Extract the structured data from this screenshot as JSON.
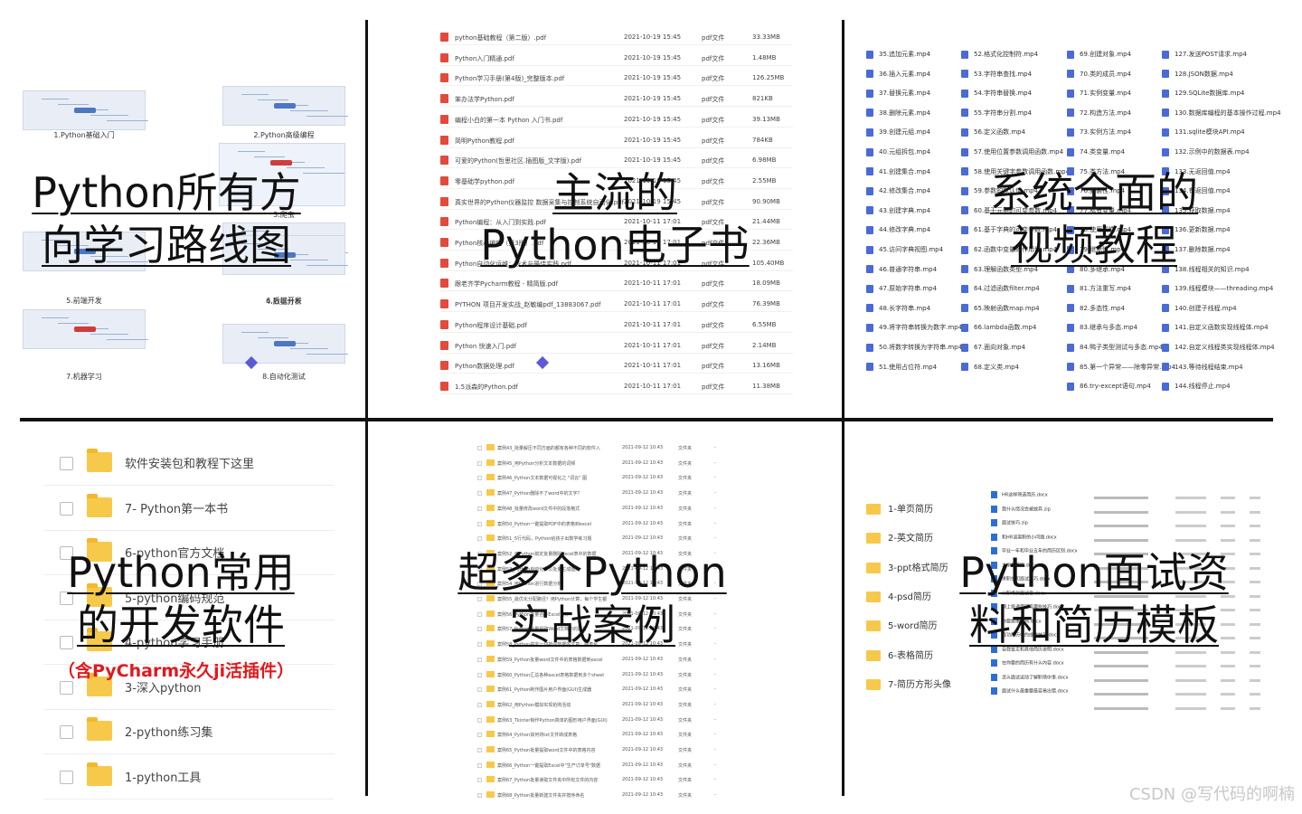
{
  "panels": {
    "p1": {
      "title_line1": "Python所有方",
      "title_line2": "向学习路线图",
      "thumbs": [
        "1.Python基础入门",
        "2.Python高级编程",
        "3.爬虫",
        "4.数据分析",
        "5.前端开发",
        "6.后端开发",
        "7.机器学习",
        "8.自动化测试"
      ]
    },
    "p2": {
      "title_line1": "主流的",
      "title_line2": "Python电子书",
      "files": [
        {
          "name": "python基础教程（第二版）.pdf",
          "date": "2021-10-19 15:45",
          "type": "pdf文件",
          "size": "33.33MB"
        },
        {
          "name": "Python入门精通.pdf",
          "date": "2021-10-19 15:45",
          "type": "pdf文件",
          "size": "1.48MB"
        },
        {
          "name": "Python学习手册(第4版)_完整版本.pdf",
          "date": "2021-10-19 15:45",
          "type": "pdf文件",
          "size": "126.25MB"
        },
        {
          "name": "笨办法学Python.pdf",
          "date": "2021-10-19 15:45",
          "type": "pdf文件",
          "size": "821KB"
        },
        {
          "name": "编程小白的第一本 Python 入门书.pdf",
          "date": "2021-10-19 15:45",
          "type": "pdf文件",
          "size": "39.13MB"
        },
        {
          "name": "简明Python教程.pdf",
          "date": "2021-10-19 15:45",
          "type": "pdf文件",
          "size": "784KB"
        },
        {
          "name": "可爱的Python(哲思社区.插图版_文字版).pdf",
          "date": "2021-10-19 15:45",
          "type": "pdf文件",
          "size": "6.98MB"
        },
        {
          "name": "零基础学python.pdf",
          "date": "2021-10-19 15:45",
          "type": "pdf文件",
          "size": "2.55MB"
        },
        {
          "name": "真实世界的Python仪器监控 数据采集与控制系统自动化.pdf",
          "date": "2021-10-19 15:45",
          "type": "pdf文件",
          "size": "90.90MB"
        },
        {
          "name": "Python编程：从入门到实践.pdf",
          "date": "2021-10-11 17:01",
          "type": "pdf文件",
          "size": "21.44MB"
        },
        {
          "name": "Python核心编程（第3版）.pdf",
          "date": "2021-10-11 17:01",
          "type": "pdf文件",
          "size": "22.36MB"
        },
        {
          "name": "Python自动化运维：技术与最佳实践.pdf",
          "date": "2021-10-11 17:01",
          "type": "pdf文件",
          "size": "105.40MB"
        },
        {
          "name": "跟老齐学Pycharm教程 - 精简版.pdf",
          "date": "2021-10-11 17:01",
          "type": "pdf文件",
          "size": "18.09MB"
        },
        {
          "name": "PYTHON 项目开发实战_赵敏编pdf_13883067.pdf",
          "date": "2021-10-11 17:01",
          "type": "pdf文件",
          "size": "76.39MB"
        },
        {
          "name": "Python程序设计基础.pdf",
          "date": "2021-10-11 17:01",
          "type": "pdf文件",
          "size": "6.55MB"
        },
        {
          "name": "Python 快速入门.pdf",
          "date": "2021-10-11 17:01",
          "type": "pdf文件",
          "size": "2.14MB"
        },
        {
          "name": "Python数据处理.pdf",
          "date": "2021-10-11 17:01",
          "type": "pdf文件",
          "size": "13.16MB"
        },
        {
          "name": "1.5派森的Python.pdf",
          "date": "2021-10-11 17:01",
          "type": "pdf文件",
          "size": "11.38MB"
        }
      ]
    },
    "p3": {
      "title_line1": "系统全面的",
      "title_line2": "视频教程",
      "col1": [
        "35.追加元素.mp4",
        "36.插入元素.mp4",
        "37.替换元素.mp4",
        "38.删除元素.mp4",
        "39.创建元组.mp4",
        "40.元组拆包.mp4",
        "41.创建集合.mp4",
        "42.修改集合.mp4",
        "43.创建字典.mp4",
        "44.修改字典.mp4",
        "45.访问字典视图.mp4",
        "46.普通字符串.mp4",
        "47.原始字符串.mp4",
        "48.长字符串.mp4",
        "49.将字符串转换为数字.mp4",
        "50.将数字转换为字符串.mp4",
        "51.使用占位符.mp4"
      ],
      "col2": [
        "52.格式化控制符.mp4",
        "53.字符串查找.mp4",
        "54.字符串替换.mp4",
        "55.字符串分割.mp4",
        "56.定义函数.mp4",
        "57.使用位置参数调用函数.mp4",
        "58.使用关键字参数调用函数.mp4",
        "59.参数的默认值.mp4",
        "60.基于元组的可变参数.mp4",
        "61.基于字典的可变参数.mp4",
        "62.函数中变量的作用域.mp4",
        "63.理解函数类型.mp4",
        "64.过滤函数filter.mp4",
        "65.映射函数map.mp4",
        "66.lambda函数.mp4",
        "67.面向对象.mp4",
        "68.定义类.mp4"
      ],
      "col3": [
        "69.创建对象.mp4",
        "70.类的成员.mp4",
        "71.实例变量.mp4",
        "72.构造方法.mp4",
        "73.实例方法.mp4",
        "74.类变量.mp4",
        "75.类方法.mp4",
        "76.封装性.mp4",
        "77.私有变量.mp4",
        "78.使用属性.mp4",
        "79.继承性.mp4",
        "80.多继承.mp4",
        "81.方法重写.mp4",
        "82.多态性.mp4",
        "83.继承与多态.mp4",
        "84.鸭子类型测试与多态.mp4",
        "85.第一个异常——除零异常.mp4",
        "86.try-except语句.mp4"
      ],
      "col4": [
        "127.发送POST请求.mp4",
        "128.JSON数据.mp4",
        "129.SQLite数据库.mp4",
        "130.数据库编程的基本操作过程.mp4",
        "131.sqlite模块API.mp4",
        "132.示例中的数据表.mp4",
        "133.无返回值.mp4",
        "134.有返回值.mp4",
        "135.获取数据.mp4",
        "136.更新数据.mp4",
        "137.删除数据.mp4",
        "138.线程相关的知识.mp4",
        "139.线程模块——threading.mp4",
        "140.创建子线程.mp4",
        "141.自定义函数实现线程体.mp4",
        "142.自定义线程类实现线程体.mp4",
        "143.等待线程结束.mp4",
        "144.线程停止.mp4"
      ]
    },
    "p4": {
      "title_line1": "Python常用",
      "title_line2": "的开发软件",
      "subtitle": "（含PyCharm永久ji活插件）",
      "folders": [
        "软件安装包和教程下这里",
        "7- Python第一本书",
        "6-python官方文档",
        "5-python编码规范",
        "4-python学习手册",
        "3-深入python",
        "2-python练习集",
        "1-python工具"
      ]
    },
    "p5": {
      "title_line1": "超多个Python",
      "title_line2": "实战案例",
      "cases": [
        {
          "name": "案例43_批量解压不同方面的都有各种不同的软件入",
          "date": "2021-09-12 10:43",
          "type": "文件夹"
        },
        {
          "name": "案例45_用Python分析文本数据的词频",
          "date": "2021-09-12 10:43",
          "type": "文件夹"
        },
        {
          "name": "案例46_Python文本数据可视化之 \"词云\" 图",
          "date": "2021-09-12 10:43",
          "type": "文件夹"
        },
        {
          "name": "案例47_Python删除不了word中的文字？",
          "date": "2021-09-12 10:43",
          "type": "文件夹"
        },
        {
          "name": "案例48_批量修改word文件中的段落格式",
          "date": "2021-09-12 10:43",
          "type": "文件夹"
        },
        {
          "name": "案例50_Python一键提取PDF中的表格到excel",
          "date": "2021-09-12 10:43",
          "type": "文件夹"
        },
        {
          "name": "案例51_5行代码，Python给孩子出数学练习题",
          "date": "2021-09-12 10:43",
          "type": "文件夹"
        },
        {
          "name": "案例52_用Python搞定批量删除Excel表中的数据",
          "date": "2021-09-12 10:43",
          "type": "文件夹"
        },
        {
          "name": "案例53_Python自动化办公批量生成图片",
          "date": "2021-09-12 10:43",
          "type": "文件夹"
        },
        {
          "name": "案例54_用Python进行数据分析",
          "date": "2021-09-12 10:43",
          "type": "文件夹"
        },
        {
          "name": "案例55_最优化分配路径？用Python计算，每个学生都",
          "date": "2021-09-12 10:43",
          "type": "文件夹"
        },
        {
          "name": "案例56_Python批量合并Excel文件",
          "date": "2021-09-12 10:43",
          "type": "文件夹"
        },
        {
          "name": "案例57_Python批量提取Word文档中的图片",
          "date": "2021-09-12 10:43",
          "type": "文件夹"
        },
        {
          "name": "案例58_Python搞定一切新闻数据的文章：图表化",
          "date": "2021-09-12 10:43",
          "type": "文件夹"
        },
        {
          "name": "案例59_Python批量word文件中的表格数据到excel",
          "date": "2021-09-12 10:43",
          "type": "文件夹"
        },
        {
          "name": "案例60_Python汇总各种excel表格数据到多个sheet",
          "date": "2021-09-12 10:43",
          "type": "文件夹"
        },
        {
          "name": "案例61_Python制作图片用户界面(GUI)生成器",
          "date": "2021-09-12 10:43",
          "type": "文件夹"
        },
        {
          "name": "案例62_用Python模拟实现抢购活动",
          "date": "2021-09-12 10:43",
          "type": "文件夹"
        },
        {
          "name": "案例63_Tkinter制作Python简单的图形用户界面(GUI)",
          "date": "2021-09-12 10:43",
          "type": "文件夹"
        },
        {
          "name": "案例64_Python如何将txt文件转成表格",
          "date": "2021-09-12 10:43",
          "type": "文件夹"
        },
        {
          "name": "案例65_Python批量提取word文件中的表格内容",
          "date": "2021-09-12 10:43",
          "type": "文件夹"
        },
        {
          "name": "案例66_Python一键提取Excel中\"生产订单号\"数据",
          "date": "2021-09-12 10:43",
          "type": "文件夹"
        },
        {
          "name": "案例67_Python批量读取文件夹中所有文件的内容",
          "date": "2021-09-12 10:43",
          "type": "文件夹"
        },
        {
          "name": "案例68_Python批量新建文件夹并按序命名",
          "date": "2021-09-12 10:43",
          "type": "文件夹"
        }
      ]
    },
    "p6": {
      "title_line1": "Python面试资",
      "title_line2": "料和简历模板",
      "folders": [
        "1-单页简历",
        "2-英文简历",
        "3-ppt格式简历",
        "4-psd简历",
        "5-word简历",
        "6-表格简历",
        "7-简历方形头像"
      ],
      "docs": [
        "HR这样筛选简历.docx",
        "我什么情况会被放弃.zip",
        "面试技巧.zip",
        "和HR谈离职的小问题.docx",
        "毕业一年和毕业五年的简历区别.docx",
        "大学生简历.docx",
        "求职信和面试技巧.docx",
        "从职场到面试官.docx",
        "网上投递简历有哪些技巧.docx",
        "你要跳槽了吗.docx",
        "成功简历中的成功技巧.docx",
        "自我鉴定和其他简历说明.docx",
        "在你要的简历有什么内容.docx",
        "怎么面试运动了解职场中事.docx",
        "面试什么最重要最容易出错.docx"
      ]
    }
  },
  "watermark": "CSDN @写代码的啊楠"
}
